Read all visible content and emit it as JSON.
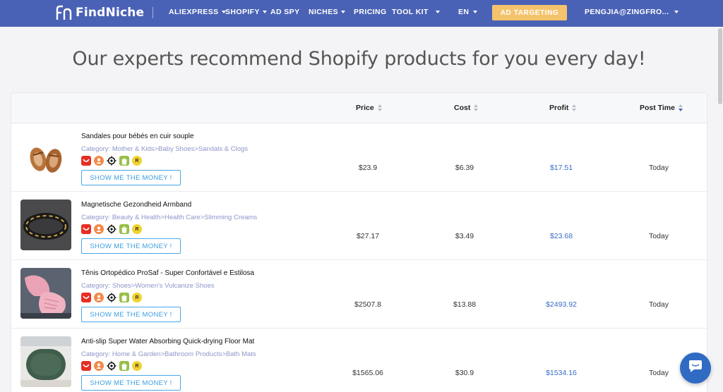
{
  "nav": {
    "brand": "FindNiche",
    "items": [
      {
        "label": "ALIEXPRESS",
        "dropdown": true
      },
      {
        "label": "SHOPIFY",
        "dropdown": true
      },
      {
        "label": "AD SPY",
        "dropdown": false
      },
      {
        "label": "NICHES",
        "dropdown": true
      },
      {
        "label": "PRICING",
        "dropdown": false
      },
      {
        "label": "TOOL KIT",
        "dropdown": true
      }
    ],
    "language": "EN",
    "ad_targeting": "AD TARGETING",
    "account": "PENGJIA@ZINGFRO...",
    "accent_color": "#4a62b5",
    "ad_button_color": "#f5c36b"
  },
  "headline": "Our experts recommend Shopify products for you every day!",
  "table": {
    "columns": [
      "Price",
      "Cost",
      "Profit",
      "Post Time"
    ],
    "active_sort": "Post Time",
    "button_label": "SHOW ME THE MONEY !",
    "badges": [
      "aliexpress-icon",
      "user-icon",
      "target-icon",
      "shopify-icon",
      "r-badge-icon"
    ],
    "badge_r_text": "R",
    "rows": [
      {
        "title": "Sandales pour bébés en cuir souple",
        "category": "Category: Mother & Kids>Baby Shoes>Sandals & Clogs",
        "price": "$23.9",
        "cost": "$6.39",
        "profit": "$17.51",
        "post_time": "Today",
        "image": "baby-sandals-image"
      },
      {
        "title": "Magnetische Gezondheid Armband",
        "category": "Category: Beauty & Health>Health Care>Slimming Creams",
        "price": "$27.17",
        "cost": "$3.49",
        "profit": "$23.68",
        "post_time": "Today",
        "image": "magnetic-bracelet-image"
      },
      {
        "title": "Tênis Ortopédico ProSaf - Super Confortável e Estilosa",
        "category": "Category: Shoes>Women's Vulcanize Shoes",
        "price": "$2507.8",
        "cost": "$13.88",
        "profit": "$2493.92",
        "post_time": "Today",
        "image": "pink-sneakers-image"
      },
      {
        "title": "Anti-slip Super Water Absorbing Quick-drying Floor Mat",
        "category": "Category: Home & Garden>Bathroom Products>Bath Mats",
        "price": "$1565.06",
        "cost": "$30.9",
        "profit": "$1534.16",
        "post_time": "Today",
        "image": "floor-mat-image"
      }
    ]
  },
  "profit_color": "#3a6cc9",
  "chat_icon": "chat-bubble-icon"
}
